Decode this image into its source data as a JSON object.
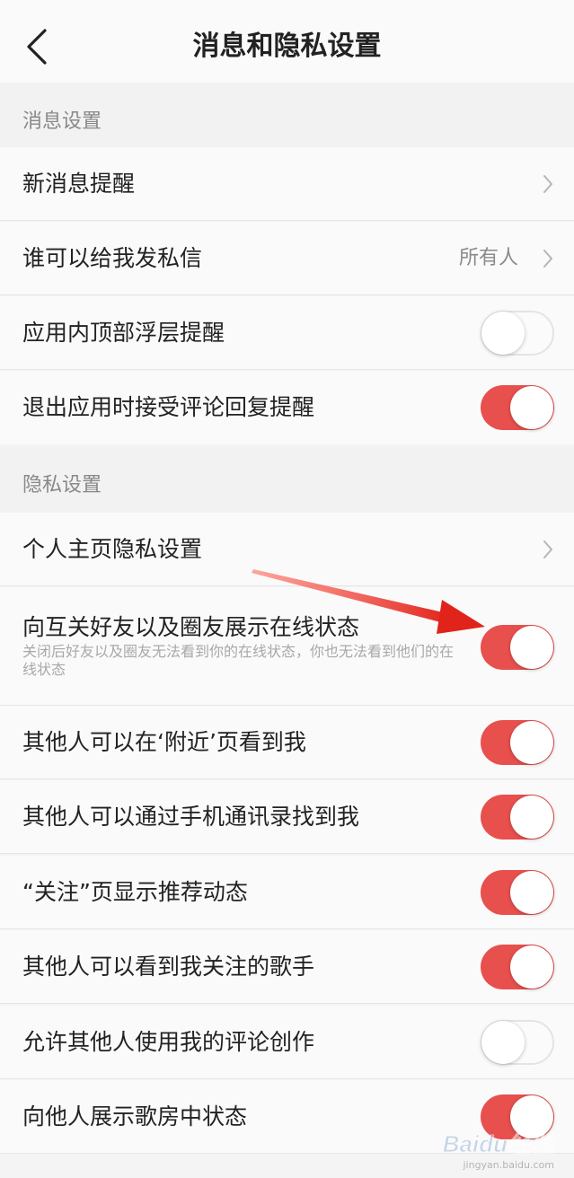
{
  "header": {
    "title": "消息和隐私设置",
    "back_icon": "chevron-left-icon"
  },
  "sections": [
    {
      "title": "消息设置",
      "items": [
        {
          "label": "新消息提醒",
          "type": "link"
        },
        {
          "label": "谁可以给我发私信",
          "type": "link",
          "value": "所有人"
        },
        {
          "label": "应用内顶部浮层提醒",
          "type": "toggle",
          "enabled": false
        },
        {
          "label": "退出应用时接受评论回复提醒",
          "type": "toggle",
          "enabled": true
        }
      ]
    },
    {
      "title": "隐私设置",
      "items": [
        {
          "label": "个人主页隐私设置",
          "type": "link"
        },
        {
          "label": "向互关好友以及圈友展示在线状态",
          "type": "toggle",
          "enabled": true,
          "description": "关闭后好友以及圈友无法看到你的在线状态，你也无法看到他们的在线状态"
        },
        {
          "label": "其他人可以在‘附近’页看到我",
          "type": "toggle",
          "enabled": true
        },
        {
          "label": "其他人可以通过手机通讯录找到我",
          "type": "toggle",
          "enabled": true
        },
        {
          "label": "“关注”页显示推荐动态",
          "type": "toggle",
          "enabled": true
        },
        {
          "label": "其他人可以看到我关注的歌手",
          "type": "toggle",
          "enabled": true
        },
        {
          "label": "允许其他人使用我的评论创作",
          "type": "toggle",
          "enabled": false
        },
        {
          "label": "向他人展示歌房中状态",
          "type": "toggle",
          "enabled": true
        }
      ]
    }
  ],
  "colors": {
    "toggle_on": "#e8504d",
    "toggle_off": "#fbfbfb",
    "annotation_arrow": "#e0241b"
  },
  "watermark": {
    "main": "Baidu经验",
    "sub": "jingyan.baidu.com"
  }
}
